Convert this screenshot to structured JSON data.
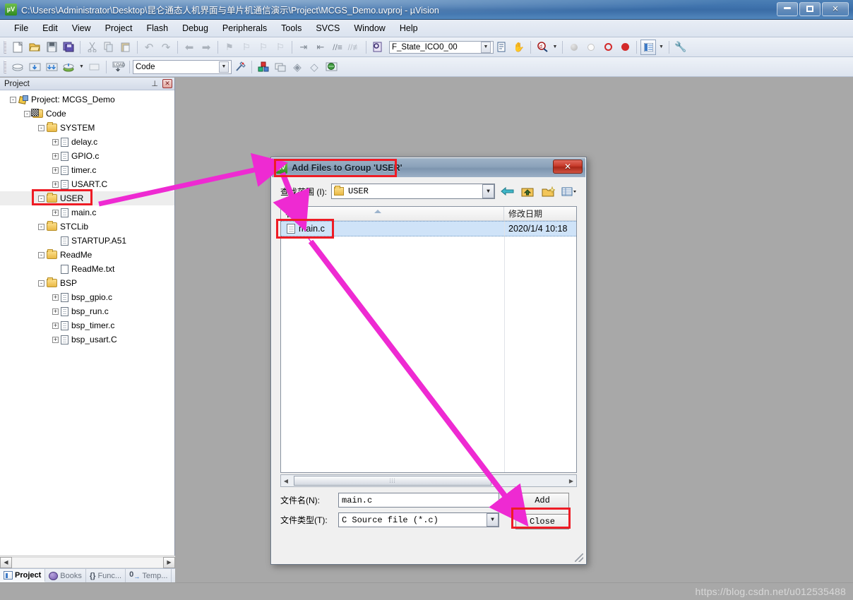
{
  "window": {
    "title": "C:\\Users\\Administrator\\Desktop\\昆仑通态人机界面与单片机通信演示\\Project\\MCGS_Demo.uvproj - µVision",
    "app_icon": "uvision-icon",
    "controls": {
      "minimize": "minimize-icon",
      "maximize": "maximize-icon",
      "close": "✕"
    }
  },
  "menubar": {
    "items": [
      "File",
      "Edit",
      "View",
      "Project",
      "Flash",
      "Debug",
      "Peripherals",
      "Tools",
      "SVCS",
      "Window",
      "Help"
    ]
  },
  "toolbar1": {
    "icons": [
      "new-file-icon",
      "open-file-icon",
      "save-icon",
      "save-all-icon",
      "cut-icon",
      "copy-icon",
      "paste-icon",
      "undo-icon",
      "redo-icon",
      "navigate-back-icon",
      "navigate-forward-icon",
      "bookmark-toggle-icon",
      "bookmark-prev-icon",
      "bookmark-next-icon",
      "bookmark-clear-icon",
      "indent-icon",
      "outdent-icon",
      "comment-icon",
      "uncomment-icon",
      "find-in-files-icon"
    ],
    "combo_value": "F_State_ICO0_00",
    "right_icons": [
      "insert-file-icon",
      "find-target-icon",
      "debug-search-icon",
      "breakpoint-disabled-icon",
      "breakpoint-empty-icon",
      "breakpoint-kill-icon",
      "breakpoint-disable-all-icon",
      "project-window-icon",
      "configure-icon"
    ]
  },
  "toolbar2": {
    "icons": [
      "translate-icon",
      "build-icon",
      "rebuild-icon",
      "batch-build-icon",
      "stop-build-icon",
      "download-icon"
    ],
    "target_combo": "Code",
    "right_icons": [
      "target-options-icon",
      "manage-project-items-icon",
      "manage-multi-project-icon",
      "components-icon",
      "packs-icon",
      "pack-installer-icon"
    ]
  },
  "project_pane": {
    "header": {
      "title": "Project",
      "pin": "pin-icon",
      "close": "close-icon"
    },
    "tree": [
      {
        "depth": 0,
        "expander": "-",
        "icon": "project-icon",
        "label": "Project: MCGS_Demo",
        "selected": false
      },
      {
        "depth": 1,
        "expander": "-",
        "icon": "code-folder-icon",
        "label": "Code",
        "selected": false
      },
      {
        "depth": 2,
        "expander": "-",
        "icon": "folder-icon",
        "label": "SYSTEM",
        "selected": false
      },
      {
        "depth": 3,
        "expander": "+",
        "icon": "c-file-icon",
        "label": "delay.c",
        "selected": false
      },
      {
        "depth": 3,
        "expander": "+",
        "icon": "c-file-icon",
        "label": "GPIO.c",
        "selected": false
      },
      {
        "depth": 3,
        "expander": "+",
        "icon": "c-file-icon",
        "label": "timer.c",
        "selected": false
      },
      {
        "depth": 3,
        "expander": "+",
        "icon": "c-file-icon",
        "label": "USART.C",
        "selected": false
      },
      {
        "depth": 2,
        "expander": "-",
        "icon": "folder-icon",
        "label": "USER",
        "selected": true
      },
      {
        "depth": 3,
        "expander": "+",
        "icon": "c-file-icon",
        "label": "main.c",
        "selected": false
      },
      {
        "depth": 2,
        "expander": "-",
        "icon": "folder-icon",
        "label": "STCLib",
        "selected": false
      },
      {
        "depth": 3,
        "expander": "",
        "icon": "asm-file-icon",
        "label": "STARTUP.A51",
        "selected": false
      },
      {
        "depth": 2,
        "expander": "-",
        "icon": "folder-icon",
        "label": "ReadMe",
        "selected": false
      },
      {
        "depth": 3,
        "expander": "",
        "icon": "txt-file-icon",
        "label": "ReadMe.txt",
        "selected": false
      },
      {
        "depth": 2,
        "expander": "-",
        "icon": "folder-icon",
        "label": "BSP",
        "selected": false
      },
      {
        "depth": 3,
        "expander": "+",
        "icon": "c-file-icon",
        "label": "bsp_gpio.c",
        "selected": false
      },
      {
        "depth": 3,
        "expander": "+",
        "icon": "c-file-icon",
        "label": "bsp_run.c",
        "selected": false
      },
      {
        "depth": 3,
        "expander": "+",
        "icon": "c-file-icon",
        "label": "bsp_timer.c",
        "selected": false
      },
      {
        "depth": 3,
        "expander": "+",
        "icon": "c-file-icon",
        "label": "bsp_usart.C",
        "selected": false
      }
    ],
    "tabs": [
      {
        "label": "Project",
        "icon": "project-tab-icon",
        "active": true
      },
      {
        "label": "Books",
        "icon": "books-tab-icon",
        "active": false
      },
      {
        "label": "Func...",
        "icon": "functions-tab-icon",
        "active": false
      },
      {
        "label": "Temp...",
        "icon": "templates-tab-icon",
        "active": false
      }
    ]
  },
  "dialog": {
    "title": "Add Files to Group 'USER'",
    "icon": "uvision-icon",
    "close_label": "✕",
    "look_in": {
      "label": "查找范围 (I):",
      "value": "USER",
      "folder_icon": "folder-icon",
      "dropdown_icon": "chevron-down-icon",
      "nav_icons": [
        "back-icon",
        "up-one-level-icon",
        "new-folder-icon",
        "views-icon"
      ]
    },
    "file_list": {
      "columns": [
        "名称",
        "修改日期"
      ],
      "sort_indicator": "sort-ascending-icon",
      "rows": [
        {
          "name": "main.c",
          "date": "2020/1/4 10:18",
          "icon": "c-file-icon",
          "selected": true
        }
      ]
    },
    "hscroll": {
      "left_arrow": "◀",
      "right_arrow": "▶",
      "thumb_grip": "⦙⦙⦙"
    },
    "fields": [
      {
        "label": "文件名(N):",
        "value": "main.c",
        "type": "text"
      },
      {
        "label": "文件类型(T):",
        "value": "C Source file (*.c)",
        "type": "combo"
      }
    ],
    "buttons": [
      {
        "label": "Add",
        "highlighted": true
      },
      {
        "label": "Close",
        "highlighted": false
      }
    ]
  },
  "annotations": {
    "highlight_color": "#ee1c25",
    "arrow_color": "#ee2ad2",
    "red_boxes": [
      {
        "name": "user-group-highlight"
      },
      {
        "name": "dialog-title-highlight"
      },
      {
        "name": "main-c-file-highlight"
      },
      {
        "name": "add-button-highlight"
      }
    ],
    "arrows": [
      {
        "name": "arrow-user-to-dialog-title"
      },
      {
        "name": "arrow-dialog-title-to-file"
      },
      {
        "name": "arrow-file-to-add-button"
      }
    ]
  },
  "watermark": {
    "text": "https://blog.csdn.net/u012535488"
  }
}
